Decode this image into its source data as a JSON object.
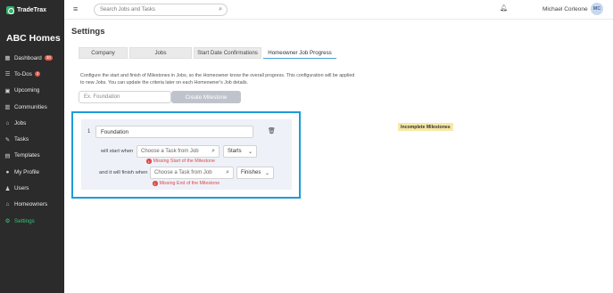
{
  "sidebar": {
    "logo_text": "TradeTrax",
    "company": "ABC Homes",
    "items": [
      {
        "icon": "dashboard-icon",
        "label": "Dashboard",
        "badge": "30"
      },
      {
        "icon": "list-icon",
        "label": "To-Dos",
        "badge": "2"
      },
      {
        "icon": "calendar-icon",
        "label": "Upcoming",
        "badge": ""
      },
      {
        "icon": "building-icon",
        "label": "Communities",
        "badge": ""
      },
      {
        "icon": "home-icon",
        "label": "Jobs",
        "badge": ""
      },
      {
        "icon": "wrench-icon",
        "label": "Tasks",
        "badge": ""
      },
      {
        "icon": "template-icon",
        "label": "Templates",
        "badge": ""
      },
      {
        "icon": "user-icon",
        "label": "My Profile",
        "badge": ""
      },
      {
        "icon": "users-icon",
        "label": "Users",
        "badge": ""
      },
      {
        "icon": "house-user-icon",
        "label": "Homeowners",
        "badge": ""
      },
      {
        "icon": "gear-icon",
        "label": "Settings",
        "badge": "",
        "active": true
      }
    ],
    "accent_color": "#3cc07a"
  },
  "topbar": {
    "search_placeholder": "Search Jobs and Tasks",
    "user_name": "Michael Corleone",
    "avatar_initials": "MC"
  },
  "main": {
    "title": "Settings",
    "tabs": [
      {
        "label": "Company",
        "active": false
      },
      {
        "label": "Jobs",
        "active": false
      },
      {
        "label": "Start Date Confirmations",
        "active": false
      },
      {
        "label": "Homeowner Job Progress",
        "active": true
      }
    ],
    "description": "Configure the start and finish of Milestones in Jobs, so the Homeowner know the overall progress. This configuration will be applied to new Jobs. You can update the criteria later on each Homeowner's Job details.",
    "milestone_placeholder": "Ex. Foundation",
    "create_button": "Create Milestone",
    "incomplete_label": "Incomplete Milestones",
    "milestone": {
      "number": "1",
      "name": "Foundation",
      "start_label": "will start when",
      "start_task_placeholder": "Choose a Task from Job",
      "start_mode": "Starts",
      "start_error": "Missing Start of the Milestone",
      "finish_label": "and it will finish when",
      "finish_task_placeholder": "Choose a Task from Job",
      "finish_mode": "Finishes",
      "finish_error": "Missing End of the Milestone"
    },
    "highlight_color": "#1d9bd8"
  }
}
